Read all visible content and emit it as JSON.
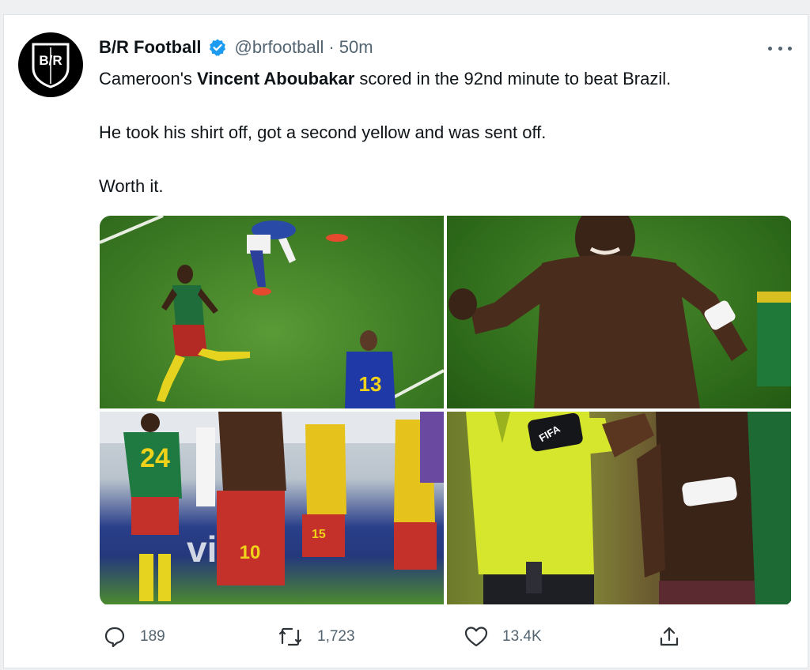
{
  "tweet": {
    "author_name": "B/R Football",
    "handle": "@brfootball",
    "separator": "·",
    "time": "50m",
    "avatar_text": "B/R",
    "lines": {
      "l1_pre": "Cameroon's ",
      "l1_bold": "Vincent Aboubakar",
      "l1_post": " scored in the 92nd minute to beat Brazil.",
      "l2": "He took his shirt off, got a second yellow and was sent off.",
      "l3": "Worth it."
    }
  },
  "media": {
    "photos": [
      {
        "icon": "photo-player-running"
      },
      {
        "icon": "photo-player-celebrating-shirtless"
      },
      {
        "icon": "photo-teammates-celebrating"
      },
      {
        "icon": "photo-referee-and-player"
      }
    ]
  },
  "actions": {
    "reply_count": "189",
    "retweet_count": "1,723",
    "like_count": "13.4K",
    "share_icon": "share-icon"
  },
  "colors": {
    "text": "#0f1419",
    "muted": "#536471",
    "verified": "#1d9bf0"
  }
}
